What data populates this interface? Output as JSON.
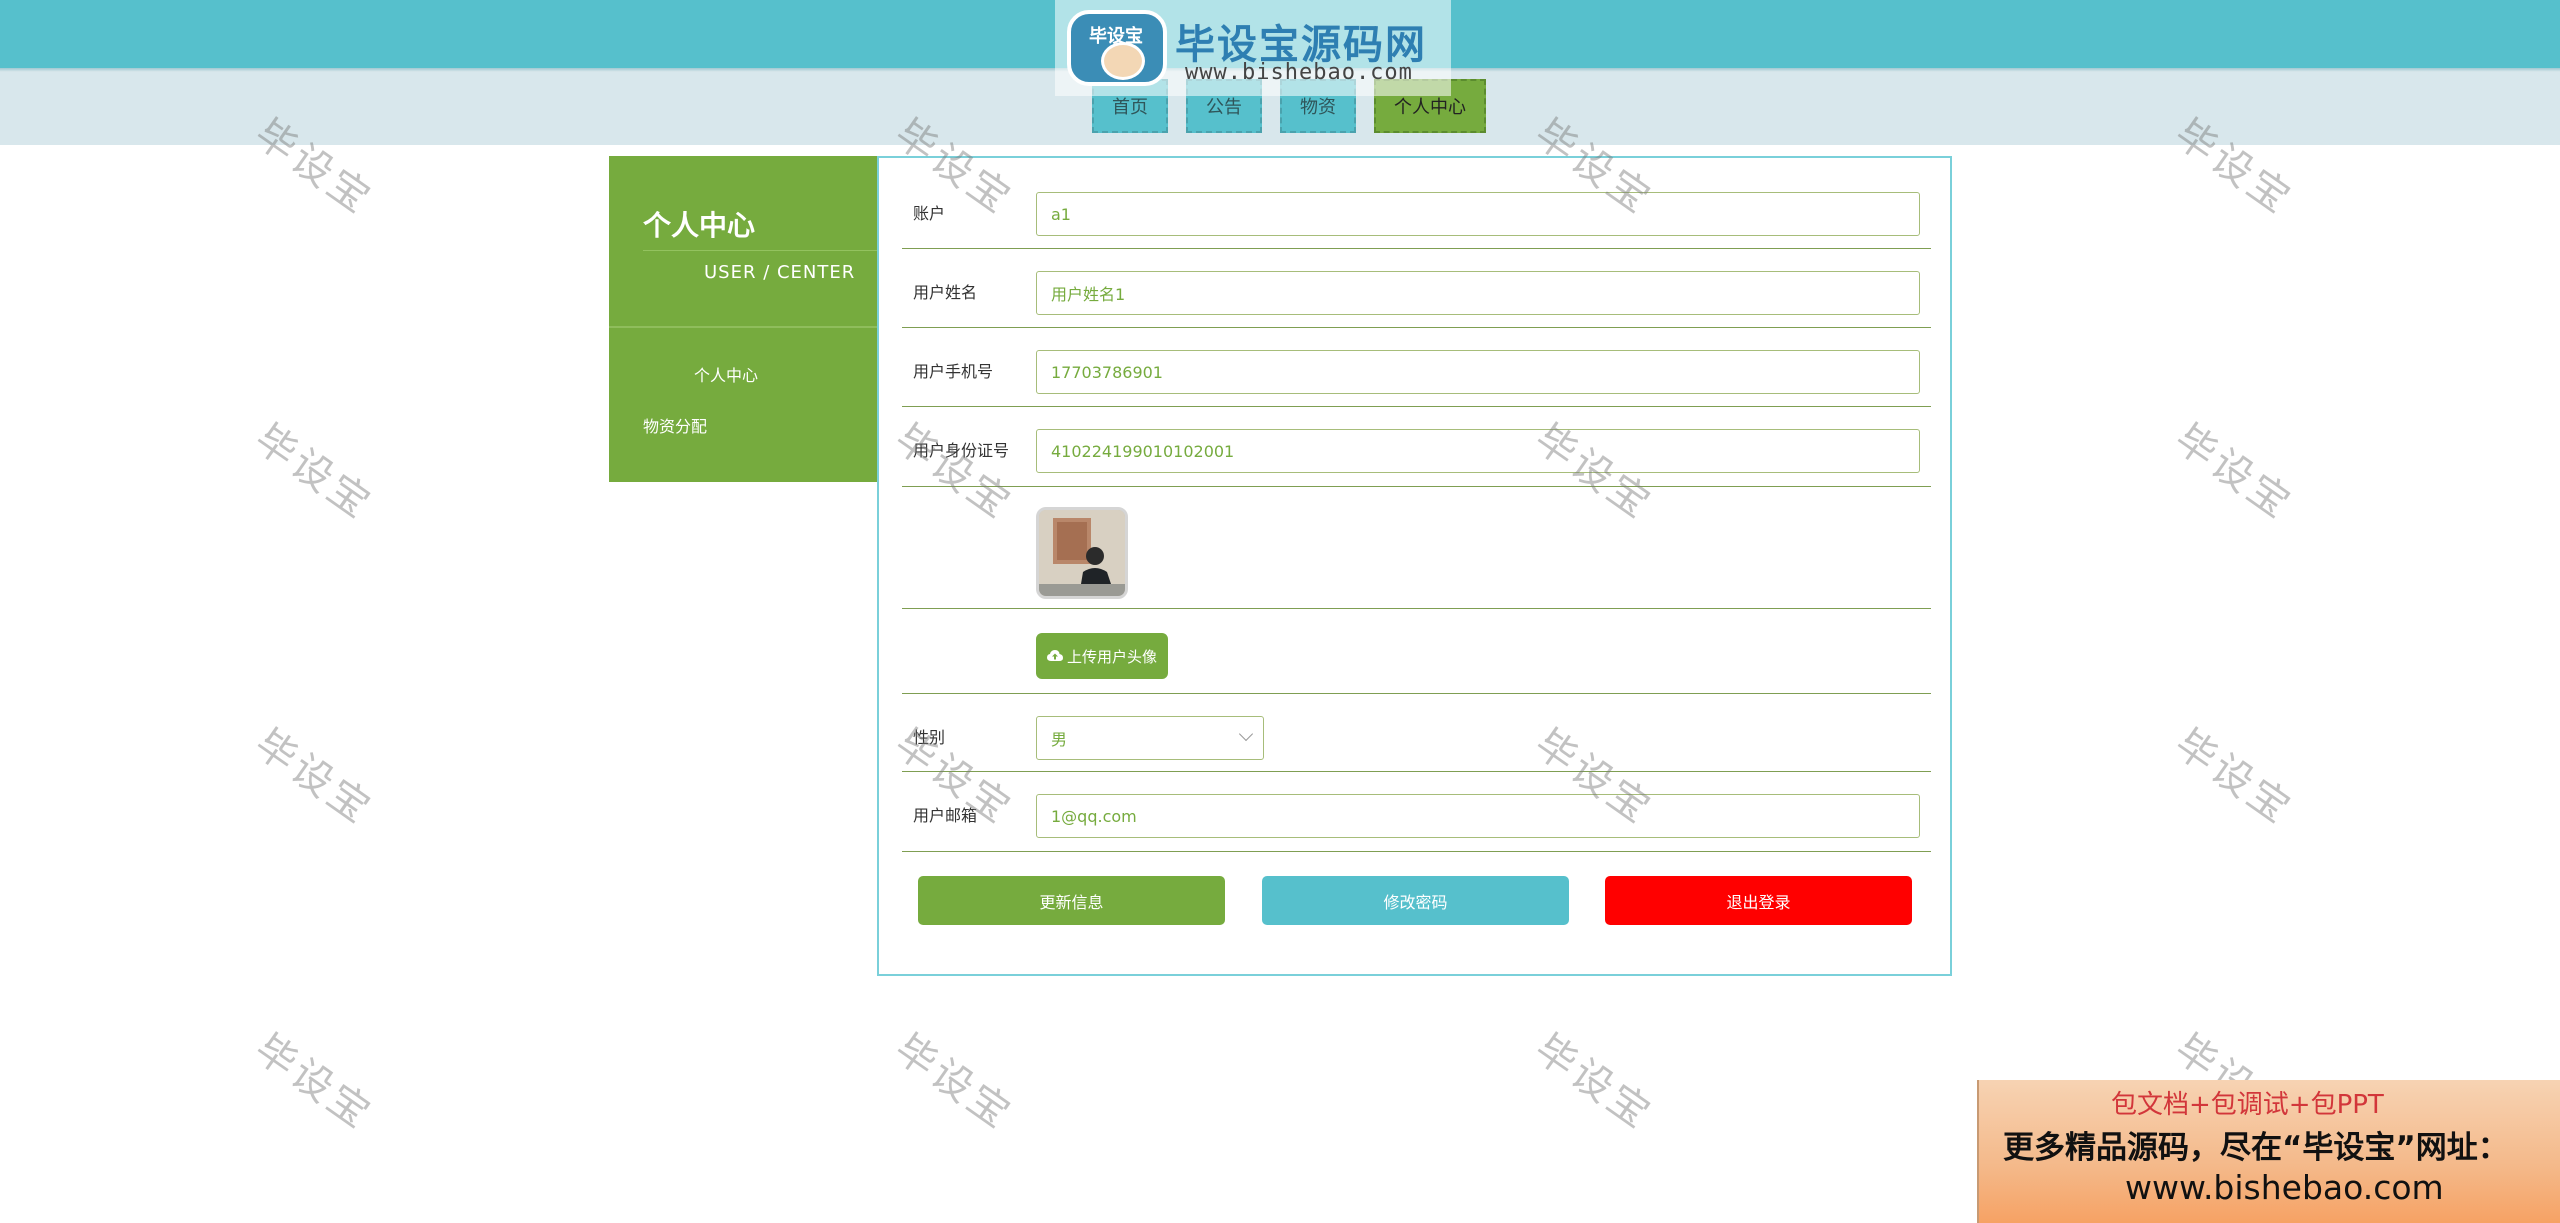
{
  "header": {
    "site_title": "...",
    "nav": [
      {
        "label": "首页"
      },
      {
        "label": "公告"
      },
      {
        "label": "物资"
      },
      {
        "label": "个人中心"
      }
    ]
  },
  "logo": {
    "badge_text": "毕设宝",
    "title": "毕设宝源码网",
    "url": "www.bishebao.com"
  },
  "sidebar": {
    "title": "个人中心",
    "subtitle": "USER / CENTER",
    "items": [
      {
        "label": "个人中心"
      },
      {
        "label": "物资分配"
      }
    ]
  },
  "form": {
    "account": {
      "label": "账户",
      "value": "a1"
    },
    "name": {
      "label": "用户姓名",
      "value": "用户姓名1"
    },
    "phone": {
      "label": "用户手机号",
      "value": "17703786901"
    },
    "idcard": {
      "label": "用户身份证号",
      "value": "410224199010102001"
    },
    "upload_label": "上传用户头像",
    "gender": {
      "label": "性别",
      "value": "男"
    },
    "email": {
      "label": "用户邮箱",
      "value": "1@qq.com"
    }
  },
  "buttons": {
    "update": "更新信息",
    "password": "修改密码",
    "logout": "退出登录"
  },
  "colors": {
    "topbar": "#56c0cc",
    "green": "#76ab3e",
    "logout_red": "#ff0000"
  },
  "watermark": "毕设宝",
  "promo": {
    "line1": "包文档+包调试+包PPT",
    "line2": "更多精品源码，尽在“毕设宝”网址：",
    "line3": "www.bishebao.com"
  }
}
